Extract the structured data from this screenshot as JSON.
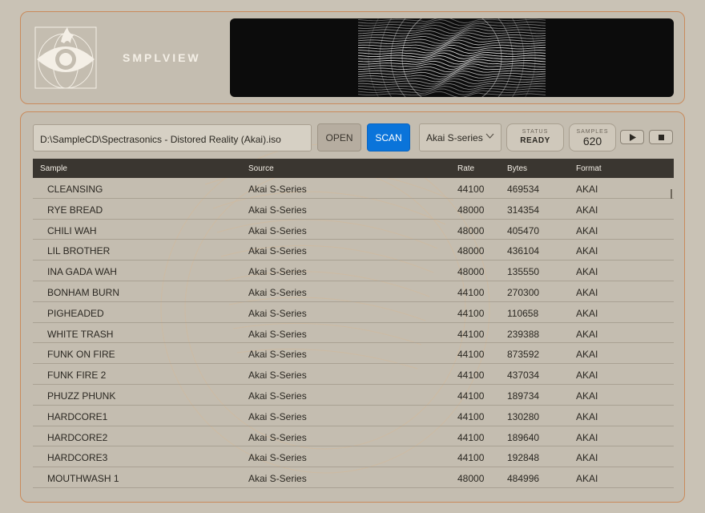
{
  "app": {
    "brand": "SMPLVIEW"
  },
  "toolbar": {
    "path_value": "D:\\SampleCD\\Spectrasonics - Distored Reality (Akai).iso",
    "open_label": "OPEN",
    "scan_label": "SCAN",
    "format_selected": "Akai S-series",
    "status_label": "STATUS",
    "status_value": "READY",
    "samples_label": "SAMPLES",
    "samples_value": "620"
  },
  "table": {
    "headers": {
      "sample": "Sample",
      "source": "Source",
      "rate": "Rate",
      "bytes": "Bytes",
      "format": "Format"
    },
    "rows": [
      {
        "sample": "CLEANSING",
        "source": "Akai S-Series",
        "rate": "44100",
        "bytes": "469534",
        "format": "AKAI"
      },
      {
        "sample": "RYE BREAD",
        "source": "Akai S-Series",
        "rate": "48000",
        "bytes": "314354",
        "format": "AKAI"
      },
      {
        "sample": "CHILI WAH",
        "source": "Akai S-Series",
        "rate": "48000",
        "bytes": "405470",
        "format": "AKAI"
      },
      {
        "sample": "LIL  BROTHER",
        "source": "Akai S-Series",
        "rate": "48000",
        "bytes": "436104",
        "format": "AKAI"
      },
      {
        "sample": "INA GADA WAH",
        "source": "Akai S-Series",
        "rate": "48000",
        "bytes": "135550",
        "format": "AKAI"
      },
      {
        "sample": "BONHAM BURN",
        "source": "Akai S-Series",
        "rate": "44100",
        "bytes": "270300",
        "format": "AKAI"
      },
      {
        "sample": "PIGHEADED",
        "source": "Akai S-Series",
        "rate": "44100",
        "bytes": "110658",
        "format": "AKAI"
      },
      {
        "sample": "WHITE TRASH",
        "source": "Akai S-Series",
        "rate": "44100",
        "bytes": "239388",
        "format": "AKAI"
      },
      {
        "sample": "FUNK ON FIRE",
        "source": "Akai S-Series",
        "rate": "44100",
        "bytes": "873592",
        "format": "AKAI"
      },
      {
        "sample": "FUNK FIRE 2",
        "source": "Akai S-Series",
        "rate": "44100",
        "bytes": "437034",
        "format": "AKAI"
      },
      {
        "sample": "PHUZZ PHUNK",
        "source": "Akai S-Series",
        "rate": "44100",
        "bytes": "189734",
        "format": "AKAI"
      },
      {
        "sample": "HARDCORE1",
        "source": "Akai S-Series",
        "rate": "44100",
        "bytes": "130280",
        "format": "AKAI"
      },
      {
        "sample": "HARDCORE2",
        "source": "Akai S-Series",
        "rate": "44100",
        "bytes": "189640",
        "format": "AKAI"
      },
      {
        "sample": "HARDCORE3",
        "source": "Akai S-Series",
        "rate": "44100",
        "bytes": "192848",
        "format": "AKAI"
      },
      {
        "sample": "MOUTHWASH 1",
        "source": "Akai S-Series",
        "rate": "48000",
        "bytes": "484996",
        "format": "AKAI"
      }
    ]
  },
  "icons": {
    "logo": "eye-flame-logo-icon",
    "dropdown": "chevron-down-icon",
    "play": "play-icon",
    "stop": "stop-icon"
  },
  "colors": {
    "accent_border": "#c98a5b",
    "scan_button": "#0a74da",
    "header_row": "#3a3630",
    "background": "#c9c2b5"
  }
}
